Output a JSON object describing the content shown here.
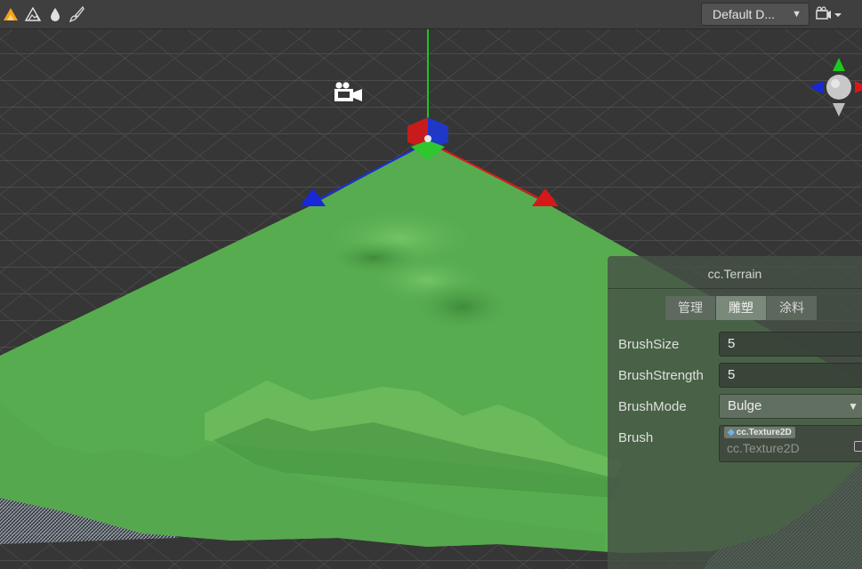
{
  "toolbar": {
    "tools": [
      {
        "icon": "move-terrain-icon",
        "active": true
      },
      {
        "icon": "sculpt-mountain-icon",
        "active": false
      },
      {
        "icon": "smooth-drop-icon",
        "active": false
      },
      {
        "icon": "paint-brush-icon",
        "active": false
      }
    ],
    "view_dropdown": "Default D...",
    "camera_menu_icon": "camera-icon",
    "accent_color": "#f4a21a"
  },
  "scene": {
    "ground_color": "#58ac50",
    "axis_colors": {
      "x": "#e01818",
      "y": "#18c818",
      "z": "#1830e0"
    },
    "camera_icon": "camera-icon",
    "orientation_gizmo": "orientation-gizmo-icon"
  },
  "panel": {
    "title": "cc.Terrain",
    "tabs": [
      {
        "label": "管理",
        "active": false
      },
      {
        "label": "雕塑",
        "active": true
      },
      {
        "label": "涂料",
        "active": false
      }
    ],
    "brush_size": {
      "label": "BrushSize",
      "value": "5"
    },
    "brush_strength": {
      "label": "BrushStrength",
      "value": "5"
    },
    "brush_mode": {
      "label": "BrushMode",
      "value": "Bulge"
    },
    "brush": {
      "label": "Brush",
      "asset_type": "cc.Texture2D",
      "placeholder": "cc.Texture2D"
    }
  }
}
